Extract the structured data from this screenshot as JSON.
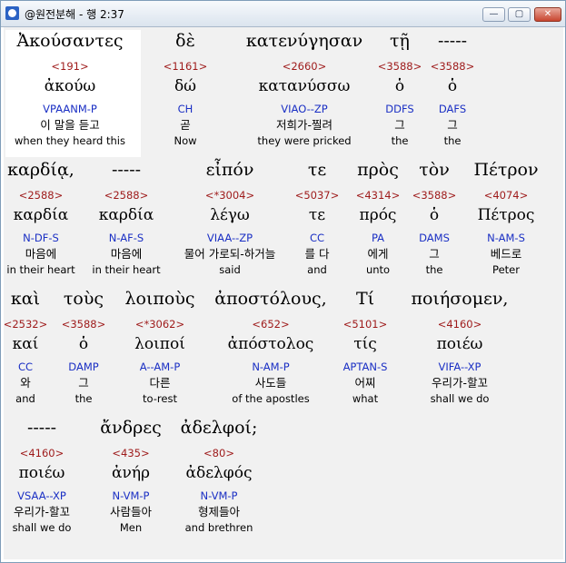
{
  "window": {
    "title": "@원전분해 - 행 2:37",
    "min_label": "—",
    "max_label": "▢",
    "close_label": "✕"
  },
  "rows": [
    [
      {
        "greek": "Ἀκούσαντες",
        "num": "<191>",
        "lemma": "ἀκούω",
        "parsing": "VPAANM-P",
        "korean": "이 말을 듣고",
        "english": "when they heard this"
      },
      {
        "greek": "δὲ",
        "num": "<1161>",
        "lemma": "δώ",
        "parsing": "CH",
        "korean": "곧",
        "english": "Now"
      },
      {
        "greek": "κατενύγησαν",
        "num": "<2660>",
        "lemma": "κατανύσσω",
        "parsing": "VIAO--ZP",
        "korean": "저희가-찔려",
        "english": "they were pricked"
      },
      {
        "greek": "τῇ",
        "num": "<3588>",
        "lemma": "ὁ",
        "parsing": "DDFS",
        "korean": "그",
        "english": "the"
      },
      {
        "greek": "-----",
        "num": "<3588>",
        "lemma": "ὁ",
        "parsing": "DAFS",
        "korean": "그",
        "english": "the"
      }
    ],
    [
      {
        "greek": "καρδίᾳ,",
        "num": "<2588>",
        "lemma": "καρδία",
        "parsing": "N-DF-S",
        "korean": "마음에",
        "english": "in their heart"
      },
      {
        "greek": "-----",
        "num": "<2588>",
        "lemma": "καρδία",
        "parsing": "N-AF-S",
        "korean": "마음에",
        "english": "in their heart"
      },
      {
        "greek": "εἶπόν",
        "num": "<*3004>",
        "lemma": "λέγω",
        "parsing": "VIAA--ZP",
        "korean": "물어 가로되-하거늘",
        "english": "said"
      },
      {
        "greek": "τε",
        "num": "<5037>",
        "lemma": "τε",
        "parsing": "CC",
        "korean": "를 다",
        "english": "and"
      },
      {
        "greek": "πρὸς",
        "num": "<4314>",
        "lemma": "πρός",
        "parsing": "PA",
        "korean": "에게",
        "english": "unto"
      },
      {
        "greek": "τὸν",
        "num": "<3588>",
        "lemma": "ὁ",
        "parsing": "DAMS",
        "korean": "그",
        "english": "the"
      },
      {
        "greek": "Πέτρον",
        "num": "<4074>",
        "lemma": "Πέτρος",
        "parsing": "N-AM-S",
        "korean": "베드로",
        "english": "Peter"
      }
    ],
    [
      {
        "greek": "καὶ",
        "num": "<2532>",
        "lemma": "καί",
        "parsing": "CC",
        "korean": "와",
        "english": "and"
      },
      {
        "greek": "τοὺς",
        "num": "<3588>",
        "lemma": "ὁ",
        "parsing": "DAMP",
        "korean": "그",
        "english": "the"
      },
      {
        "greek": "λοιποὺς",
        "num": "<*3062>",
        "lemma": "λοιποί",
        "parsing": "A--AM-P",
        "korean": "다른",
        "english": "to-rest"
      },
      {
        "greek": "ἀποστόλους,",
        "num": "<652>",
        "lemma": "ἀπόστολος",
        "parsing": "N-AM-P",
        "korean": "사도들",
        "english": "of the apostles"
      },
      {
        "greek": "Τί",
        "num": "<5101>",
        "lemma": "τίς",
        "parsing": "APTAN-S",
        "korean": "어찌",
        "english": "what"
      },
      {
        "greek": "ποιήσομεν,",
        "num": "<4160>",
        "lemma": "ποιέω",
        "parsing": "VIFA--XP",
        "korean": "우리가-할꼬",
        "english": "shall we do"
      }
    ],
    [
      {
        "greek": "-----",
        "num": "<4160>",
        "lemma": "ποιέω",
        "parsing": "VSAA--XP",
        "korean": "우리가-할꼬",
        "english": "shall we do"
      },
      {
        "greek": "ἄνδρες",
        "num": "<435>",
        "lemma": "ἀνήρ",
        "parsing": "N-VM-P",
        "korean": "사람들아",
        "english": "Men"
      },
      {
        "greek": "ἀδελφοί;",
        "num": "<80>",
        "lemma": "ἀδελφός",
        "parsing": "N-VM-P",
        "korean": "형제들아",
        "english": "and brethren"
      }
    ]
  ]
}
